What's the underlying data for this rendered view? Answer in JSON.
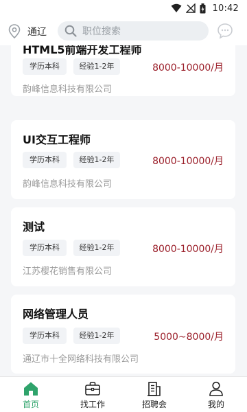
{
  "status_bar": {
    "time": "10:42"
  },
  "header": {
    "location": "通辽",
    "search_placeholder": "职位搜索"
  },
  "jobs": [
    {
      "title": "HTML5前端开发工程师",
      "education": "学历本科",
      "experience": "经验1-2年",
      "salary": "8000-10000/月",
      "company": "韵峰信息科技有限公司"
    },
    {
      "title": "UI交互工程师",
      "education": "学历本科",
      "experience": "经验1-2年",
      "salary": "8000-10000/月",
      "company": "韵峰信息科技有限公司"
    },
    {
      "title": "测试",
      "education": "学历本科",
      "experience": "经验1-2年",
      "salary": "8000-10000/月",
      "company": "江苏樱花销售有限公司"
    },
    {
      "title": "网络管理人员",
      "education": "学历本科",
      "experience": "经验1-2年",
      "salary": "5000~8000/月",
      "company": "通辽市十全网络科技有限公司"
    }
  ],
  "tabs": [
    {
      "label": "首页",
      "icon": "home-icon",
      "active": true
    },
    {
      "label": "找工作",
      "icon": "briefcase-icon",
      "active": false
    },
    {
      "label": "招聘会",
      "icon": "building-icon",
      "active": false
    },
    {
      "label": "我的",
      "icon": "person-icon",
      "active": false
    }
  ],
  "colors": {
    "accent": "#2fa36b",
    "salary": "#9b1f2a",
    "background": "#f5f6f8"
  }
}
